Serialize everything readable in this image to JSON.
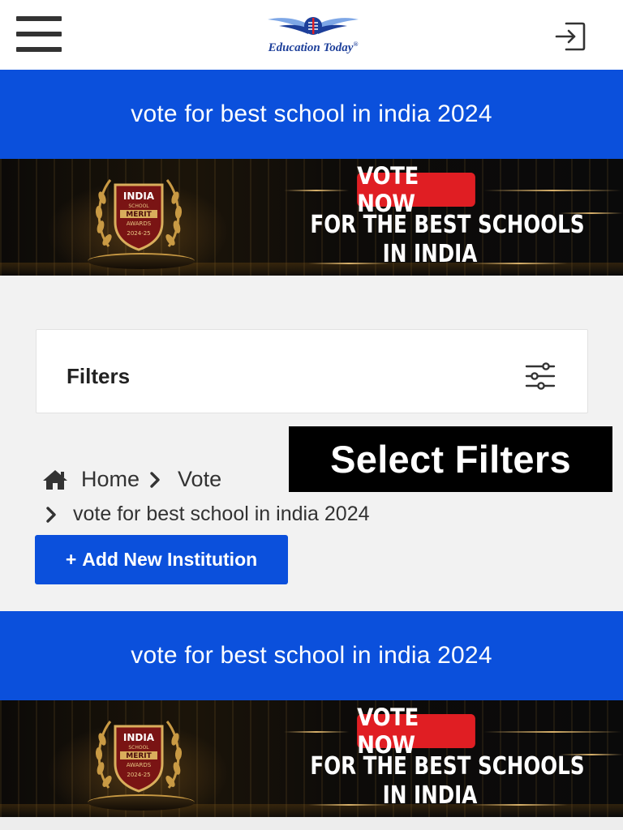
{
  "header": {
    "logo_text": "Education Today",
    "logo_mark": "®",
    "menu_icon": "hamburger-menu-icon",
    "login_icon": "login-icon"
  },
  "band_top": {
    "title": "vote for best school in india 2024"
  },
  "banner": {
    "vote_now": "VOTE NOW",
    "line1": "FOR THE  BEST SCHOOLS",
    "line2": "IN INDIA",
    "badge_line1": "INDIA",
    "badge_line2": "SCHOOL",
    "badge_line3": "MERIT",
    "badge_line4": "AWARDS",
    "badge_year": "2024-25"
  },
  "filters": {
    "label": "Filters",
    "icon": "sliders-icon"
  },
  "overlay": {
    "label": "Select Filters"
  },
  "breadcrumb": {
    "home": "Home",
    "vote": "Vote",
    "current": "vote for best school in india 2024",
    "home_icon": "home-icon",
    "separator_icon": "chevron-right-icon"
  },
  "actions": {
    "add_institution_plus": "+",
    "add_institution": "Add New Institution"
  },
  "band_bottom": {
    "title": "vote for best school in india 2024"
  },
  "colors": {
    "brand_blue": "#0b50dc",
    "vote_red": "#e01e23",
    "banner_gold": "#c99a44"
  }
}
